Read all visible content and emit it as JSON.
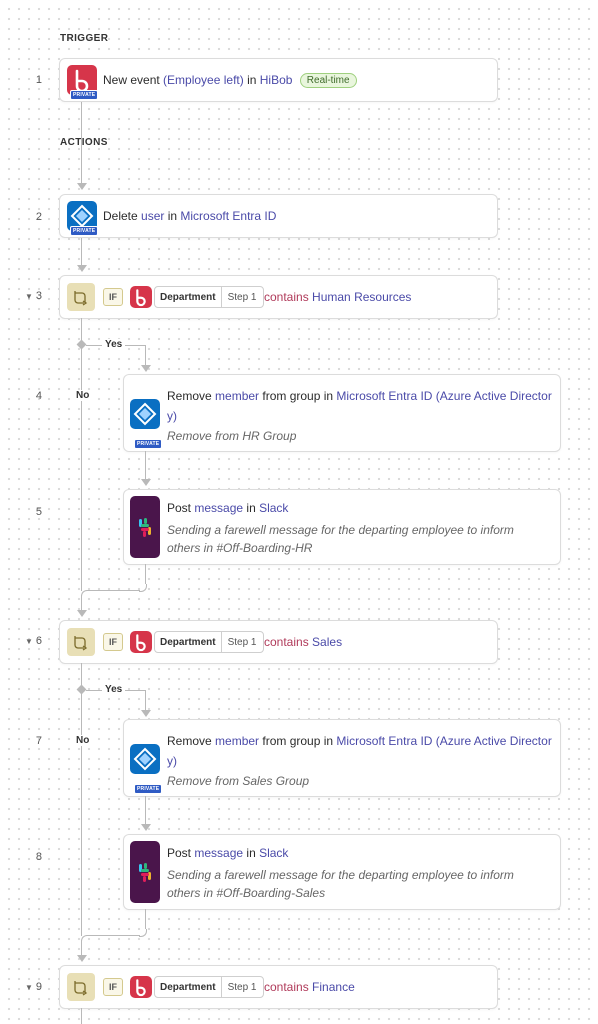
{
  "sections": {
    "trigger": "TRIGGER",
    "actions": "ACTIONS"
  },
  "steps": {
    "s1": {
      "num": "1",
      "pre": "New event ",
      "dp1": "(Employee left)",
      "mid": " in ",
      "app": "HiBob",
      "badge": "Real-time",
      "private": "PRIVATE"
    },
    "s2": {
      "num": "2",
      "pre": "Delete ",
      "dp1": "user",
      "mid": " in ",
      "app": "Microsoft Entra ID",
      "private": "PRIVATE"
    },
    "s3": {
      "num": "3",
      "if": "IF",
      "field": "Department",
      "step": "Step 1",
      "op": "contains",
      "val": "Human Resources"
    },
    "s4": {
      "num": "4",
      "pre": "Remove ",
      "dp1": "member",
      "mid": " from group in ",
      "app_line1": "Microsoft Entra ID (Azure Active Director",
      "app_line2": "y)",
      "desc": "Remove from HR Group",
      "private": "PRIVATE"
    },
    "s5": {
      "num": "5",
      "pre": "Post ",
      "dp1": "message",
      "mid": " in ",
      "app": "Slack",
      "desc1": "Sending a farewell message for the departing employee to inform",
      "desc2": "others in #Off-Boarding-HR"
    },
    "s6": {
      "num": "6",
      "if": "IF",
      "field": "Department",
      "step": "Step 1",
      "op": "contains",
      "val": "Sales"
    },
    "s7": {
      "num": "7",
      "pre": "Remove ",
      "dp1": "member",
      "mid": " from group in ",
      "app_line1": "Microsoft Entra ID (Azure Active Director",
      "app_line2": "y)",
      "desc": "Remove from Sales Group",
      "private": "PRIVATE"
    },
    "s8": {
      "num": "8",
      "pre": "Post ",
      "dp1": "message",
      "mid": " in ",
      "app": "Slack",
      "desc1": "Sending a farewell message for the departing employee to inform",
      "desc2": "others in #Off-Boarding-Sales"
    },
    "s9": {
      "num": "9",
      "if": "IF",
      "field": "Department",
      "step": "Step 1",
      "op": "contains",
      "val": "Finance"
    }
  },
  "branch": {
    "yes": "Yes",
    "no": "No"
  },
  "colors": {
    "hibob": "#d6354a",
    "entra": "#0a6fc2",
    "slack": "#4a154b",
    "if_bg": "#e8dfb6",
    "datapill": "#4a4aa8",
    "operator": "#b03a5a"
  }
}
